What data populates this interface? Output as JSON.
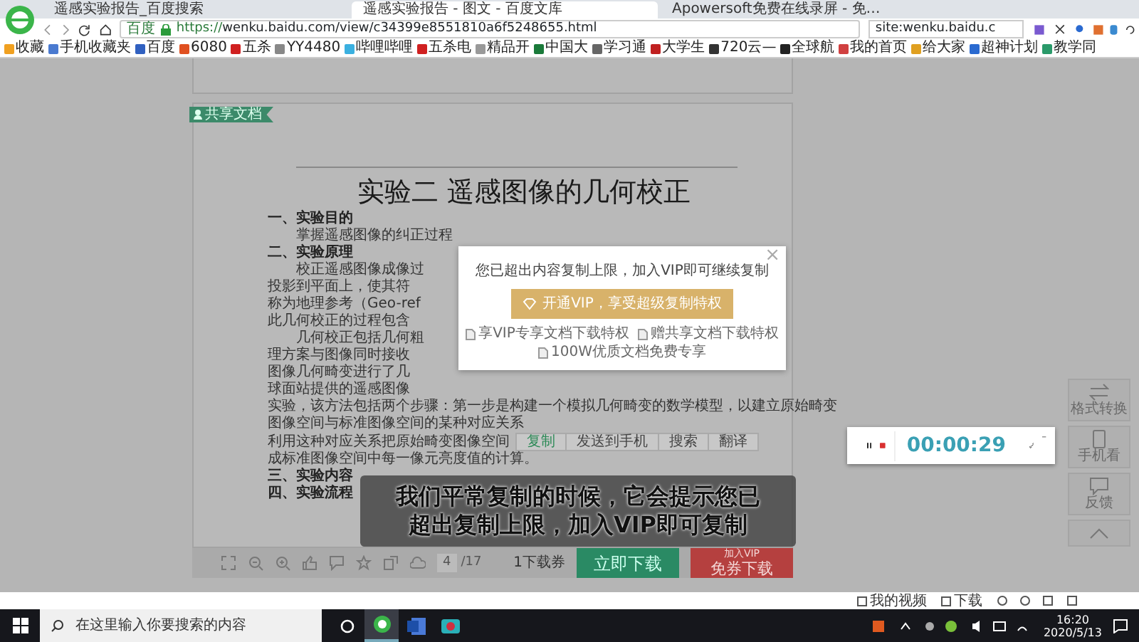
{
  "browser": {
    "tabs": [
      {
        "title": "遥感实验报告_百度搜索",
        "selected": false
      },
      {
        "title": "遥感实验报告 - 图文 - 百度文库",
        "selected": true
      },
      {
        "title": "Apowersoft免费在线录屏 - 免…",
        "selected": false
      }
    ],
    "address": {
      "site_label": "百度",
      "url": "https://wenku.baidu.com/view/c34399e8551810a6f5248655.html"
    },
    "search": {
      "value": "site:wenku.baidu.c"
    },
    "bookmarks": [
      "收藏",
      "手机收藏夹",
      "百度",
      "6080",
      "五杀",
      "YY4480",
      "哔哩哔哩",
      "五杀电",
      "精品开",
      "中国大",
      "学习通",
      "大学生",
      "720云—",
      "全球航",
      "我的首页",
      "给大家",
      "超神计划",
      "教学同"
    ]
  },
  "document": {
    "ribbon": "共享文档",
    "title": "实验二  遥感图像的几何校正",
    "lines": [
      {
        "kind": "heading",
        "text": "一、实验目的"
      },
      {
        "kind": "indent",
        "text": "掌握遥感图像的纠正过程"
      },
      {
        "kind": "heading",
        "text": "二、实验原理"
      },
      {
        "kind": "indent",
        "text": "校正遥感图像成像过"
      },
      {
        "kind": "plain",
        "text": "投影到平面上，使其符"
      },
      {
        "kind": "plain",
        "text": "称为地理参考（Geo-ref"
      },
      {
        "kind": "plain",
        "text": "此几何校正的过程包含"
      },
      {
        "kind": "indent",
        "text": "几何校正包括几何粗"
      },
      {
        "kind": "plain",
        "text": "理方案与图像同时接收"
      },
      {
        "kind": "plain",
        "text": "图像几何畸变进行了几"
      },
      {
        "kind": "plain",
        "text": "球面站提供的遥感图像"
      },
      {
        "kind": "plain",
        "text": "实验，该方法包括两个步骤：第一步是构建一个模拟几何畸变的数学模型，以建立原始畸变"
      },
      {
        "kind": "plain",
        "text": "图像空间与标准图像空间的某种对应关系"
      },
      {
        "kind": "plain",
        "text": "利用这种对应关系把原始畸变图像空间",
        "selection_toolbar": [
          {
            "label": "复制",
            "selected": true
          },
          {
            "label": "发送到手机",
            "selected": false
          },
          {
            "label": "搜索",
            "selected": false
          },
          {
            "label": "翻译",
            "selected": false
          }
        ]
      },
      {
        "kind": "plain",
        "text": "成标准图像空间中每一像元亮度值的计算。"
      },
      {
        "kind": "heading",
        "text": "三、实验内容"
      },
      {
        "kind": "heading",
        "text": "四、实验流程"
      }
    ]
  },
  "copy_limit_dialog": {
    "close": "×",
    "message": "您已超出内容复制上限，加入VIP即可继续复制",
    "button": "开通VIP，享受超级复制特权",
    "features": [
      "享VIP专享文档下载特权",
      "赠共享文档下载特权",
      "100W优质文档免费专享"
    ]
  },
  "subtitle": {
    "lines": [
      "我们平常复制的时候，它会提示您已",
      "超出复制上限，加入VIP即可复制"
    ]
  },
  "doc_toolbar": {
    "page": "4",
    "page_total": "/17",
    "coupons": "1下载券",
    "download_button": "立即下载",
    "vip_caption": "加入VIP",
    "vip_button": "免券下载"
  },
  "recorder": {
    "time": "00:00:29"
  },
  "side_tools": [
    {
      "kind": "convert",
      "label": "格式转换"
    },
    {
      "kind": "phone",
      "label": "手机看"
    },
    {
      "kind": "feedback",
      "label": "反馈"
    },
    {
      "kind": "top"
    }
  ],
  "status_bar": {
    "items": [
      "我的视频",
      "下载"
    ]
  },
  "taskbar": {
    "search_placeholder": "在这里输入你要搜索的内容",
    "time": "16:20",
    "date": "2020/5/13"
  }
}
